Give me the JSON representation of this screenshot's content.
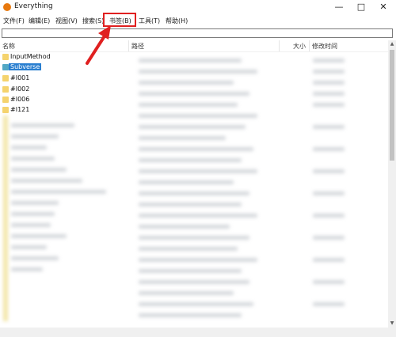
{
  "window": {
    "title": "Everything",
    "minimize_glyph": "—",
    "maximize_glyph": "□",
    "close_glyph": "✕"
  },
  "menu": {
    "file": "文件(F)",
    "edit": "编辑(E)",
    "view": "视图(V)",
    "search": "搜索(S)",
    "bookmarks": "书签(B)",
    "tools": "工具(T)",
    "help": "帮助(H)"
  },
  "search": {
    "value": "",
    "placeholder": ""
  },
  "columns": {
    "name": "名称",
    "path": "路径",
    "size": "大小",
    "modified": "修改时间"
  },
  "rows": [
    {
      "label": "InputMethod",
      "icon": "folder-icon"
    },
    {
      "label": "Subverse",
      "icon": "folder-icon",
      "selected": true
    },
    {
      "label": "#I001",
      "icon": "folder-icon"
    },
    {
      "label": "#I002",
      "icon": "folder-icon"
    },
    {
      "label": "#I006",
      "icon": "folder-icon"
    },
    {
      "label": "#I121",
      "icon": "folder-icon"
    }
  ],
  "colors": {
    "accent_selection": "#2a7fd0",
    "highlight_box": "#e02020",
    "annotation_arrow": "#e02020",
    "folder": "#f5d36d",
    "app_icon": "#e8790f"
  }
}
